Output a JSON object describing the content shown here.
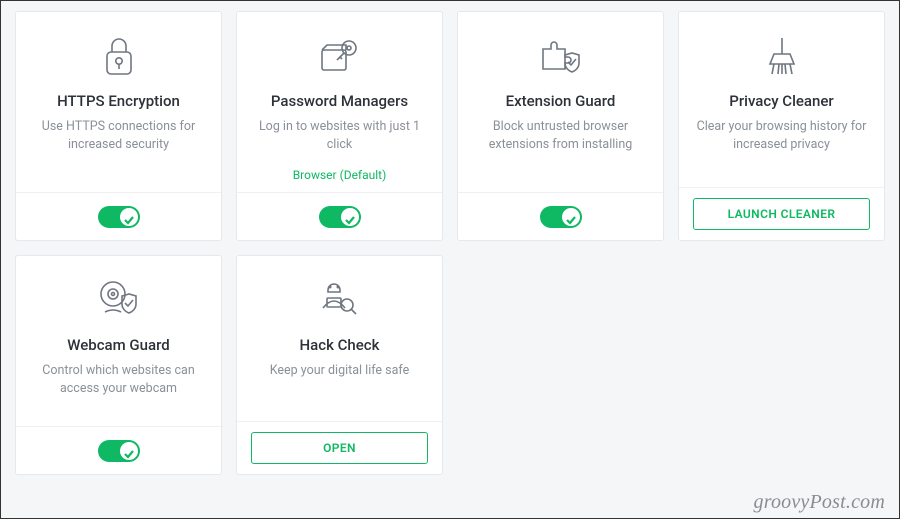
{
  "cards": [
    {
      "id": "https-encryption",
      "icon": "lock-icon",
      "title": "HTTPS Encryption",
      "desc": "Use HTTPS connections for increased security",
      "extra": null,
      "action": {
        "type": "toggle",
        "on": true
      }
    },
    {
      "id": "password-managers",
      "icon": "key-icon",
      "title": "Password Managers",
      "desc": "Log in to websites with just 1 click",
      "extra": "Browser (Default)",
      "action": {
        "type": "toggle",
        "on": true
      }
    },
    {
      "id": "extension-guard",
      "icon": "puzzle-shield-icon",
      "title": "Extension Guard",
      "desc": "Block untrusted browser extensions from installing",
      "extra": null,
      "action": {
        "type": "toggle",
        "on": true
      }
    },
    {
      "id": "privacy-cleaner",
      "icon": "broom-icon",
      "title": "Privacy Cleaner",
      "desc": "Clear your browsing history for increased privacy",
      "extra": null,
      "action": {
        "type": "button",
        "label": "LAUNCH CLEANER"
      }
    },
    {
      "id": "webcam-guard",
      "icon": "webcam-shield-icon",
      "title": "Webcam Guard",
      "desc": "Control which websites can access your webcam",
      "extra": null,
      "action": {
        "type": "toggle",
        "on": true
      }
    },
    {
      "id": "hack-check",
      "icon": "hacker-icon",
      "title": "Hack Check",
      "desc": "Keep your digital life safe",
      "extra": null,
      "action": {
        "type": "button",
        "label": "OPEN"
      }
    }
  ],
  "watermark": "groovyPost.com"
}
